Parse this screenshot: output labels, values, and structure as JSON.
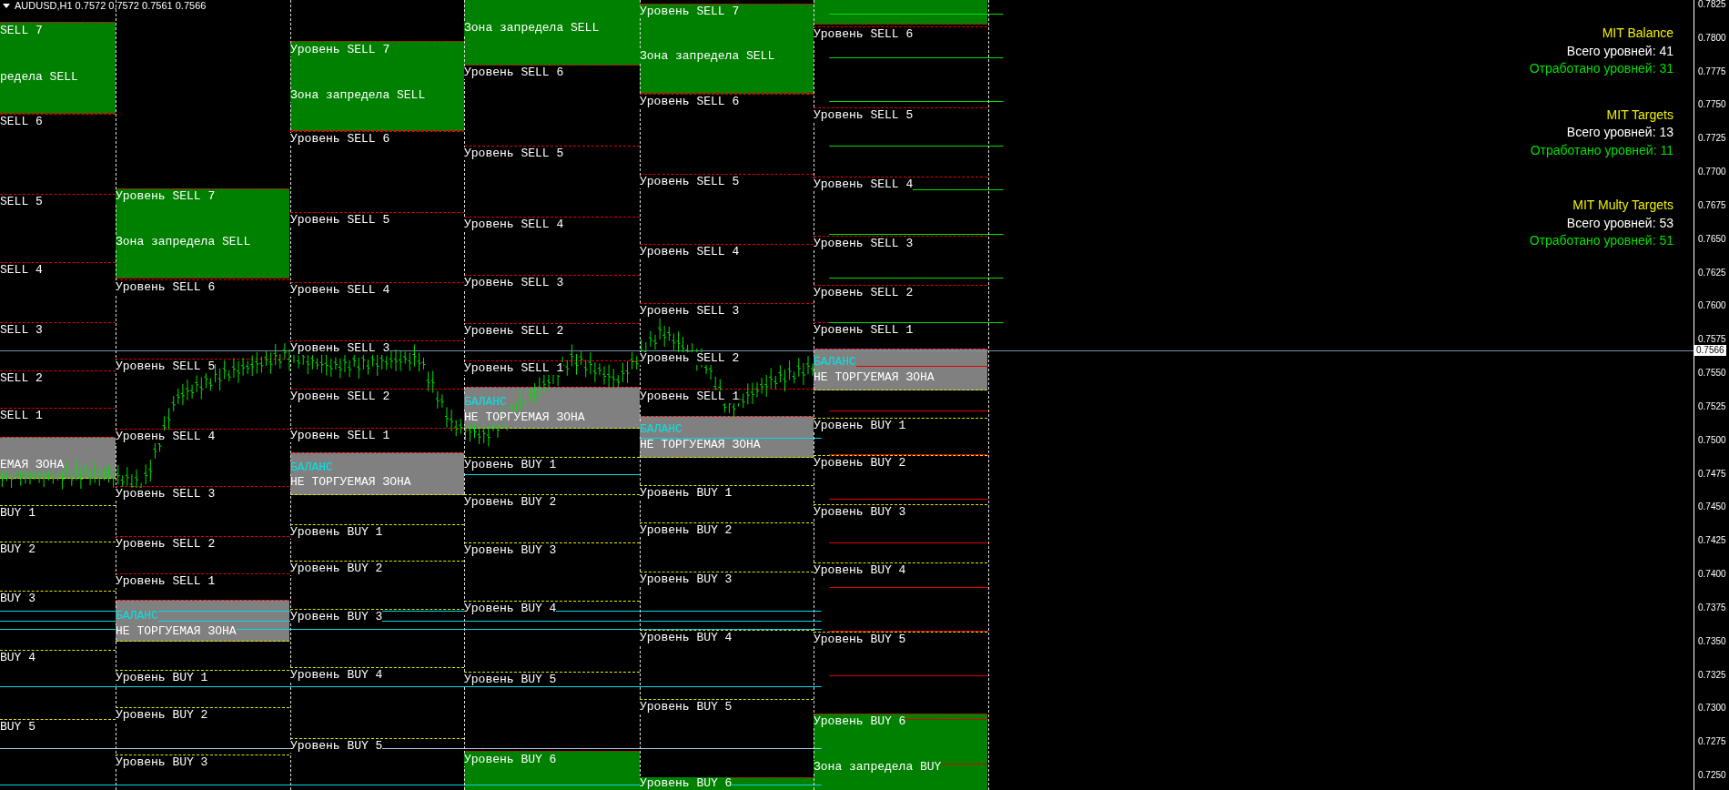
{
  "header": {
    "symbol": "AUDUSD,H1",
    "prices": "0.7572 0.7572 0.7561 0.7566"
  },
  "columns": [
    {
      "items": [
        {
          "kind": "sell-zone",
          "texts": [
            "SELL 7",
            "редела SELL"
          ]
        },
        {
          "kind": "sell",
          "label": "SELL 6"
        },
        {
          "kind": "sell",
          "label": "SELL 5"
        },
        {
          "kind": "sell",
          "label": "SELL 4"
        },
        {
          "kind": "sell",
          "label": "SELL 3"
        },
        {
          "kind": "sell",
          "label": "SELL 2"
        },
        {
          "kind": "sell",
          "label": "SELL 1"
        },
        {
          "kind": "balance",
          "texts": [
            "ЕМАЯ ЗОНА"
          ]
        },
        {
          "kind": "buy",
          "label": "BUY 1"
        },
        {
          "kind": "buy",
          "label": "BUY 2"
        },
        {
          "kind": "buy",
          "label": "BUY 3"
        },
        {
          "kind": "buy",
          "label": "BUY 4"
        },
        {
          "kind": "buy",
          "label": "BUY 5"
        }
      ]
    },
    {
      "items": [
        {
          "kind": "sell-zone",
          "texts": [
            "Уровень SELL 7",
            "Зона запредела SELL"
          ]
        },
        {
          "kind": "sell",
          "label": "Уровень SELL 6"
        },
        {
          "kind": "sell",
          "label": "Уровень SELL 5"
        },
        {
          "kind": "sell",
          "label": "Уровень SELL 4"
        },
        {
          "kind": "sell",
          "label": "Уровень SELL 3"
        },
        {
          "kind": "sell",
          "label": "Уровень SELL 2"
        },
        {
          "kind": "sell",
          "label": "Уровень SELL 1"
        },
        {
          "kind": "balance",
          "texts": [
            "БАЛАНС",
            "НЕ ТОРГУЕМАЯ ЗОНА"
          ]
        },
        {
          "kind": "buy",
          "label": "Уровень BUY 1"
        },
        {
          "kind": "buy",
          "label": "Уровень BUY 2"
        },
        {
          "kind": "buy",
          "label": "Уровень BUY 3"
        }
      ]
    },
    {
      "items": [
        {
          "kind": "sell-zone",
          "texts": [
            "Уровень SELL 7",
            "Зона запредела SELL"
          ]
        },
        {
          "kind": "sell",
          "label": "Уровень SELL 6"
        },
        {
          "kind": "sell",
          "label": "Уровень SELL 5"
        },
        {
          "kind": "sell",
          "label": "Уровень SELL 4"
        },
        {
          "kind": "sell",
          "label": "Уровень SELL 3"
        },
        {
          "kind": "sell",
          "label": "Уровень SELL 2"
        },
        {
          "kind": "sell",
          "label": "Уровень SELL 1"
        },
        {
          "kind": "balance",
          "texts": [
            "БАЛАНС",
            "НЕ ТОРГУЕМАЯ ЗОНА"
          ]
        },
        {
          "kind": "buy",
          "label": "Уровень BUY 1"
        },
        {
          "kind": "buy",
          "label": "Уровень BUY 2"
        },
        {
          "kind": "buy",
          "label": "Уровень BUY 3"
        },
        {
          "kind": "buy",
          "label": "Уровень BUY 4"
        },
        {
          "kind": "buy",
          "label": "Уровень BUY 5"
        }
      ]
    },
    {
      "items": [
        {
          "kind": "sell-zone",
          "texts": [
            "Зона запредела SELL"
          ]
        },
        {
          "kind": "sell",
          "label": "Уровень SELL 6"
        },
        {
          "kind": "sell",
          "label": "Уровень SELL 5"
        },
        {
          "kind": "sell",
          "label": "Уровень SELL 4"
        },
        {
          "kind": "sell",
          "label": "Уровень SELL 3"
        },
        {
          "kind": "sell",
          "label": "Уровень SELL 2"
        },
        {
          "kind": "sell",
          "label": "Уровень SELL 1"
        },
        {
          "kind": "balance",
          "texts": [
            "БАЛАНС",
            "НЕ ТОРГУЕМАЯ ЗОНА"
          ]
        },
        {
          "kind": "buy",
          "label": "Уровень BUY 1"
        },
        {
          "kind": "buy",
          "label": "Уровень BUY 2"
        },
        {
          "kind": "buy",
          "label": "Уровень BUY 3"
        },
        {
          "kind": "buy",
          "label": "Уровень BUY 4"
        },
        {
          "kind": "buy",
          "label": "Уровень BUY 5"
        },
        {
          "kind": "buy-zone",
          "texts": [
            "Уровень BUY 6"
          ]
        }
      ]
    },
    {
      "items": [
        {
          "kind": "sell-zone",
          "texts": [
            "Уровень SELL 7",
            "Зона запредела SELL"
          ]
        },
        {
          "kind": "sell",
          "label": "Уровень SELL 6"
        },
        {
          "kind": "sell",
          "label": "Уровень SELL 5"
        },
        {
          "kind": "sell",
          "label": "Уровень SELL 4"
        },
        {
          "kind": "sell",
          "label": "Уровень SELL 3"
        },
        {
          "kind": "sell",
          "label": "Уровень SELL 2"
        },
        {
          "kind": "sell",
          "label": "Уровень SELL 1"
        },
        {
          "kind": "balance",
          "texts": [
            "БАЛАНС",
            "НЕ ТОРГУЕМАЯ ЗОНА"
          ]
        },
        {
          "kind": "buy",
          "label": "Уровень BUY 1"
        },
        {
          "kind": "buy",
          "label": "Уровень BUY 2"
        },
        {
          "kind": "buy",
          "label": "Уровень BUY 3"
        },
        {
          "kind": "buy",
          "label": "Уровень BUY 4"
        },
        {
          "kind": "buy",
          "label": "Уровень BUY 5"
        },
        {
          "kind": "buy-zone",
          "texts": [
            "Уровень BUY 6"
          ]
        }
      ]
    },
    {
      "items": [
        {
          "kind": "sell-zone"
        },
        {
          "kind": "sell",
          "label": "Уровень SELL 6"
        },
        {
          "kind": "sell",
          "label": "Уровень SELL 5"
        },
        {
          "kind": "sell",
          "label": "Уровень SELL 4"
        },
        {
          "kind": "sell",
          "label": "Уровень SELL 3"
        },
        {
          "kind": "sell",
          "label": "Уровень SELL 2"
        },
        {
          "kind": "sell",
          "label": "Уровень SELL 1"
        },
        {
          "kind": "balance",
          "texts": [
            "БАЛАНС",
            "НЕ ТОРГУЕМАЯ ЗОНА"
          ]
        },
        {
          "kind": "buy",
          "label": "Уровень BUY 1"
        },
        {
          "kind": "buy",
          "label": "Уровень BUY 2"
        },
        {
          "kind": "buy",
          "label": "Уровень BUY 3"
        },
        {
          "kind": "buy",
          "label": "Уровень BUY 4"
        },
        {
          "kind": "buy",
          "label": "Уровень BUY 5"
        },
        {
          "kind": "buy-zone",
          "texts": [
            "Уровень BUY 6",
            "Зона запредела BUY"
          ]
        }
      ]
    }
  ],
  "info": [
    {
      "title": "MIT Balance",
      "total": "Всего уровней: 41",
      "done": "Отработано уровней: 31"
    },
    {
      "title": "MIT Targets",
      "total": "Всего уровней: 13",
      "done": "Отработано уровней: 11"
    },
    {
      "title": "MIT Multy Targets",
      "total": "Всего уровней: 53",
      "done": "Отработано уровней: 51"
    }
  ],
  "price_axis": {
    "ticks": [
      "0.7825",
      "0.7800",
      "0.7775",
      "0.7750",
      "0.7725",
      "0.7700",
      "0.7675",
      "0.7650",
      "0.7625",
      "0.7600",
      "0.7575",
      "0.7550",
      "0.7525",
      "0.7500",
      "0.7475",
      "0.7450",
      "0.7425",
      "0.7400",
      "0.7375",
      "0.7350",
      "0.7325",
      "0.7300",
      "0.7275",
      "0.7250"
    ],
    "current": "0.7566"
  }
}
